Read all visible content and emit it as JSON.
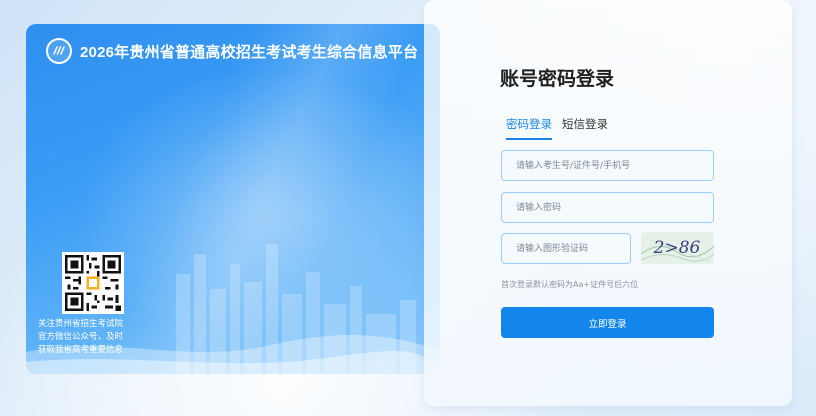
{
  "banner": {
    "title": "2026年贵州省普通高校招生考试考生综合信息平台",
    "qr_caption_lines": [
      "关注贵州省招生考试院",
      "官方微信公众号，及时",
      "获取我省高考重要信息"
    ]
  },
  "login": {
    "title": "账号密码登录",
    "tabs": [
      {
        "label": "密码登录",
        "active": true
      },
      {
        "label": "短信登录",
        "active": false
      }
    ],
    "account_placeholder": "请输入考生号/证件号/手机号",
    "password_placeholder": "请输入密码",
    "captcha_placeholder": "请输入图形验证码",
    "captcha_text": "2>86",
    "hint": "首次登录默认密码为Aa+证件号后六位",
    "submit_label": "立即登录"
  },
  "colors": {
    "accent": "#1485eb",
    "banner_blue": "#2f8ff0",
    "input_border": "#9fcdf3"
  },
  "icons": {
    "logo": "provincial-exam-logo-icon",
    "qr": "wechat-qr-code"
  }
}
